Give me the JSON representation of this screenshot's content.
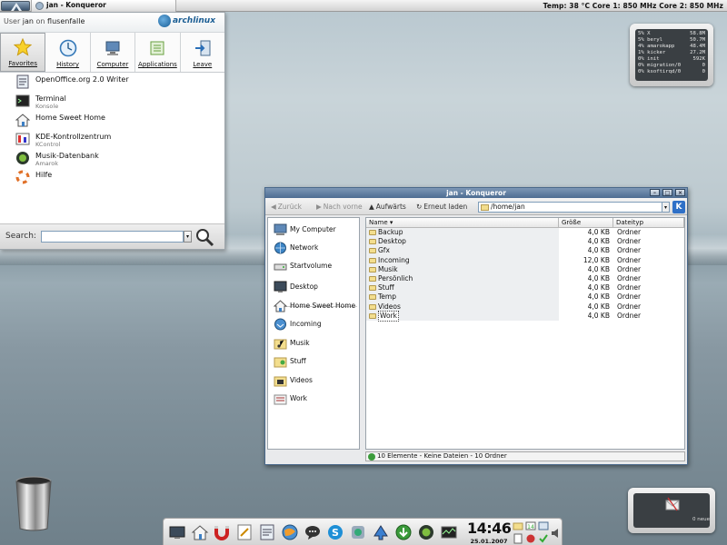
{
  "top_panel": {
    "task_title": "jan - Konqueror",
    "system_info": "Temp: 38 °C  Core 1: 850 MHz  Core 2: 850 MHz"
  },
  "kickoff": {
    "user_prefix": "User",
    "user_name": "jan",
    "user_on": "on",
    "host": "flusenfalle",
    "brand": "archlinux",
    "tabs": [
      "Favorites",
      "History",
      "Computer",
      "Applications",
      "Leave"
    ],
    "items": [
      {
        "name": "OpenOffice.org 2.0 Writer",
        "sub": ""
      },
      {
        "name": "Terminal",
        "sub": "Konsole"
      },
      {
        "name": "Home Sweet Home",
        "sub": ""
      },
      {
        "name": "KDE-Kontrollzentrum",
        "sub": "KControl"
      },
      {
        "name": "Musik-Datenbank",
        "sub": "Amarok"
      },
      {
        "name": "Hilfe",
        "sub": ""
      }
    ],
    "search_label": "Search:",
    "search_value": ""
  },
  "sysmon": {
    "rows": [
      [
        "5% X",
        "58.8M"
      ],
      [
        "5% beryl",
        "50.7M"
      ],
      [
        "4% amarokapp",
        "48.4M"
      ],
      [
        "1% kicker",
        "27.2M"
      ],
      [
        "0% init",
        "592K"
      ],
      [
        "0% migration/0",
        "0"
      ],
      [
        "0% ksoftirqd/0",
        "0"
      ]
    ]
  },
  "konqueror": {
    "title": "jan - Konqueror",
    "toolbar": {
      "back": "Zurück",
      "forward": "Nach vorne",
      "up": "Aufwärts",
      "reload": "Erneut laden"
    },
    "url": "/home/jan",
    "sidebar": [
      "My Computer",
      "Network",
      "Startvolume",
      "Desktop",
      "Home Sweet Home",
      "Incoming",
      "Musik",
      "Stuff",
      "Videos",
      "Work"
    ],
    "columns": [
      "Name",
      "Größe",
      "Dateityp"
    ],
    "files": [
      {
        "name": "Backup",
        "size": "4,0 KB",
        "type": "Ordner"
      },
      {
        "name": "Desktop",
        "size": "4,0 KB",
        "type": "Ordner"
      },
      {
        "name": "Gfx",
        "size": "4,0 KB",
        "type": "Ordner"
      },
      {
        "name": "Incoming",
        "size": "12,0 KB",
        "type": "Ordner"
      },
      {
        "name": "Musik",
        "size": "4,0 KB",
        "type": "Ordner"
      },
      {
        "name": "Persönlich",
        "size": "4,0 KB",
        "type": "Ordner"
      },
      {
        "name": "Stuff",
        "size": "4,0 KB",
        "type": "Ordner"
      },
      {
        "name": "Temp",
        "size": "4,0 KB",
        "type": "Ordner"
      },
      {
        "name": "Videos",
        "size": "4,0 KB",
        "type": "Ordner"
      },
      {
        "name": "Work",
        "size": "4,0 KB",
        "type": "Ordner"
      }
    ],
    "status": "10 Elemente - Keine Dateien - 10 Ordner"
  },
  "note_widget": {
    "label": "0 neue"
  },
  "bottom_panel": {
    "time": "14:46",
    "date": "25.01.2007"
  }
}
